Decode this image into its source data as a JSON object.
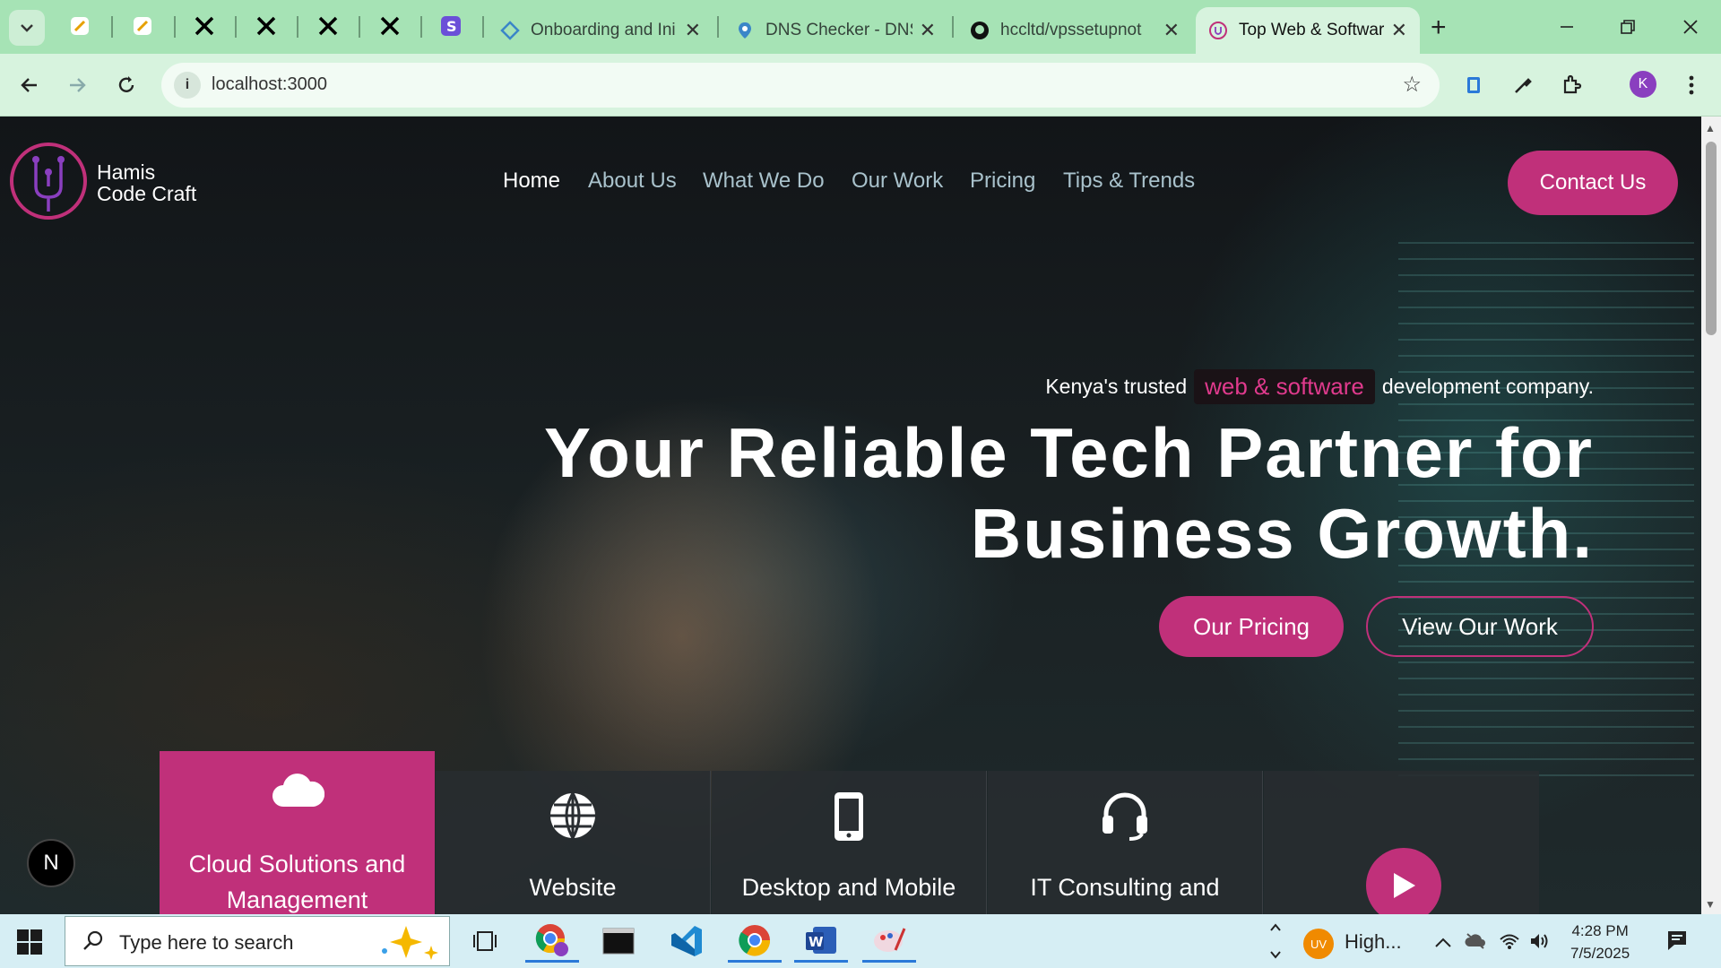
{
  "browser": {
    "tabs": [
      {
        "title": "Onboarding and Ini",
        "icon": "diamond-icon"
      },
      {
        "title": "DNS Checker - DNS",
        "icon": "map-pin-icon"
      },
      {
        "title": "hccltd/vpssetupnot",
        "icon": "github-icon"
      },
      {
        "title": "Top Web & Softwar",
        "icon": "logo-icon",
        "active": true
      }
    ],
    "url": "localhost:3000",
    "profile_initial": "K"
  },
  "site": {
    "brand_line1": "Hamis",
    "brand_line2": "Code Craft",
    "nav": [
      "Home",
      "About Us",
      "What We Do",
      "Our Work",
      "Pricing",
      "Tips & Trends"
    ],
    "contact": "Contact Us",
    "tagline_pre": "Kenya's trusted",
    "tagline_highlight": "web & software",
    "tagline_post": "development company.",
    "headline_line1": "Your Reliable Tech Partner for",
    "headline_line2": "Business Growth.",
    "btn_pricing": "Our Pricing",
    "btn_work": "View Our Work",
    "services": [
      {
        "label": "Cloud Solutions and Management",
        "icon": "cloud-icon"
      },
      {
        "label": "Website",
        "icon": "globe-icon"
      },
      {
        "label": "Desktop and Mobile",
        "icon": "mobile-icon"
      },
      {
        "label": "IT Consulting and",
        "icon": "headset-icon"
      }
    ],
    "badge": "N"
  },
  "taskbar": {
    "search_placeholder": "Type here to search",
    "weather_text": "High...",
    "weather_badge": "UV",
    "time": "4:28 PM",
    "date": "7/5/2025"
  },
  "colors": {
    "accent": "#c0307a",
    "chrome_tabstrip": "#a6e3b5",
    "chrome_toolbar": "#d7f3de"
  }
}
